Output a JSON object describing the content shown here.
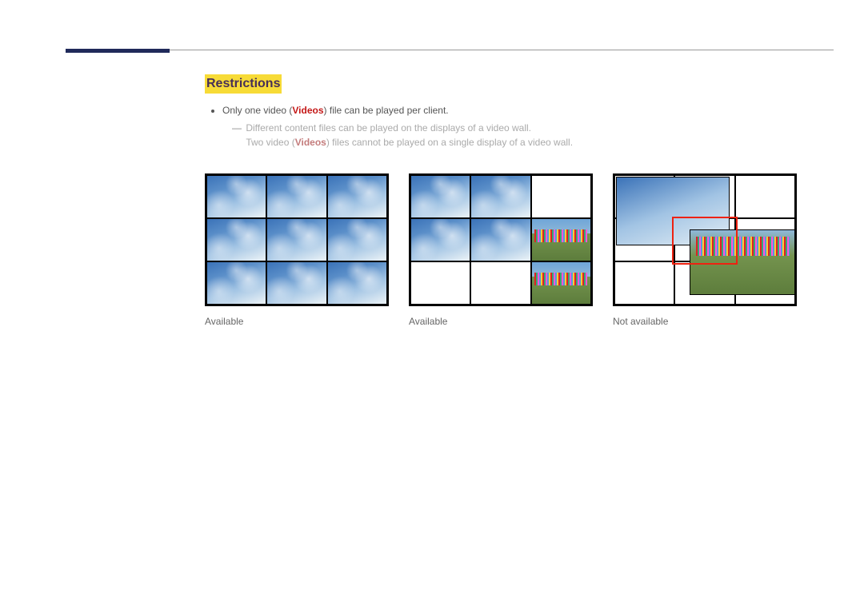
{
  "heading": "Restrictions",
  "bullet": {
    "pre": "Only one video (",
    "hl": "Videos",
    "post": ") file can be played per client."
  },
  "sub1": "Different content files can be played on the displays of a video wall.",
  "sub2": {
    "pre": "Two video (",
    "hl": "Videos",
    "post": ") files cannot be played on a single display of a video wall."
  },
  "figures": {
    "fig1": {
      "caption": "Available",
      "desc": "One video spanning full 3x3 wall"
    },
    "fig2": {
      "caption": "Available",
      "desc": "Two videos on separate displays"
    },
    "fig3": {
      "caption": "Not available",
      "desc": "Two videos overlap same display"
    }
  }
}
